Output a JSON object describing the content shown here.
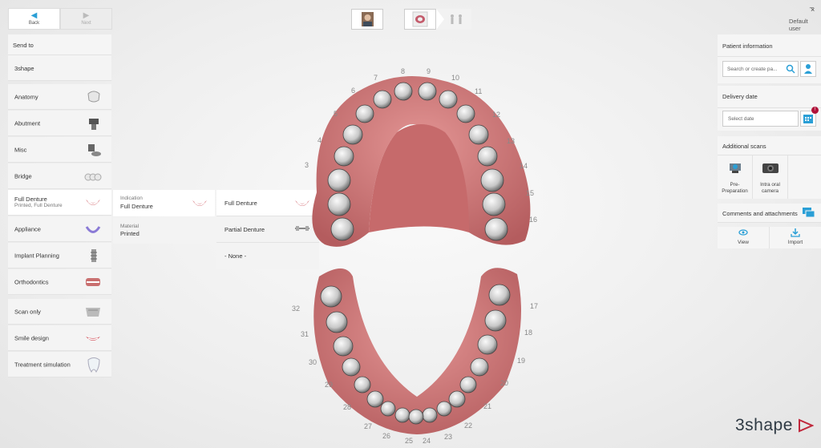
{
  "nav": {
    "back_label": "Back",
    "next_label": "Next"
  },
  "top": {
    "user": "Default user",
    "minimize": "_",
    "close": "×"
  },
  "send_to": {
    "title": "Send to",
    "destination": "3shape"
  },
  "categories": [
    {
      "label": "Anatomy",
      "icon": "crown-icon"
    },
    {
      "label": "Abutment",
      "icon": "abutment-icon"
    },
    {
      "label": "Misc",
      "icon": "misc-icon"
    },
    {
      "label": "Bridge",
      "icon": "bridge-icon"
    },
    {
      "label": "Full Denture",
      "sub": "Printed, Full Denture",
      "icon": "denture-icon"
    },
    {
      "label": "Appliance",
      "icon": "appliance-icon"
    },
    {
      "label": "Implant Planning",
      "icon": "implant-icon"
    },
    {
      "label": "Orthodontics",
      "icon": "orthodontics-icon"
    },
    {
      "label": "Scan only",
      "icon": "scan-icon"
    },
    {
      "label": "Smile design",
      "icon": "smile-icon"
    },
    {
      "label": "Treatment simulation",
      "icon": "tooth-icon"
    }
  ],
  "indication": {
    "label": "Indication",
    "value": "Full Denture"
  },
  "material": {
    "label": "Material",
    "value": "Printed"
  },
  "options": [
    "Full Denture",
    "Partial Denture",
    "- None -"
  ],
  "patient": {
    "title": "Patient information",
    "search_placeholder": "Search or create pa..."
  },
  "delivery": {
    "title": "Delivery date",
    "placeholder": "Select date",
    "badge": "!"
  },
  "scans": {
    "title": "Additional scans",
    "items": [
      "Pre-Preparation",
      "Intra oral camera"
    ]
  },
  "comments": {
    "title": "Comments and attachments",
    "view": "View",
    "import": "Import"
  },
  "logo": "3shape",
  "upper_numbers": [
    "8",
    "9",
    "7",
    "10",
    "6",
    "11",
    "5",
    "12",
    "4",
    "13",
    "3",
    "14",
    "15",
    "16"
  ],
  "lower_numbers": [
    "17",
    "18",
    "19",
    "20",
    "21",
    "22",
    "23",
    "24",
    "25",
    "26",
    "27",
    "28",
    "29",
    "30",
    "31",
    "32"
  ],
  "colors": {
    "accent": "#2a9fd6",
    "gum": "#c96f6f",
    "badge": "#b0123a"
  }
}
